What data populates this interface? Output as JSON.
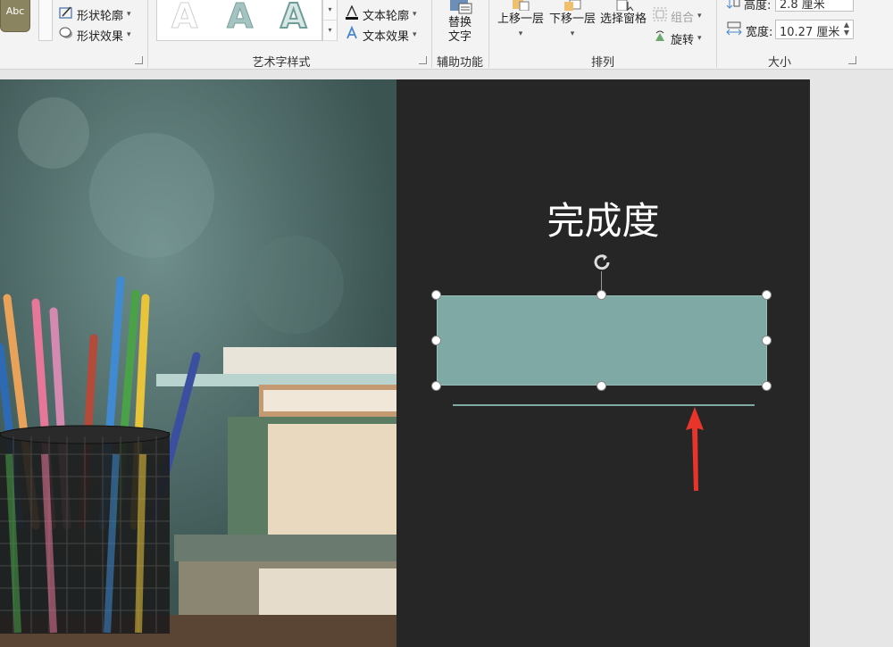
{
  "ribbon": {
    "abc_swatch": "Abc",
    "shape_outline": "形状轮廓",
    "shape_effects": "形状效果",
    "wordart_group_label": "艺术字样式",
    "text_outline": "文本轮廓",
    "text_effects": "文本效果",
    "wordart_sample": "A",
    "alt_text_line1": "替换",
    "alt_text_line2": "文字",
    "accessibility_label": "辅助功能",
    "bring_forward": "上移一层",
    "send_backward": "下移一层",
    "selection_pane": "选择窗格",
    "group": "组合",
    "rotate": "旋转",
    "arrange_label": "排列",
    "height_label": "高度:",
    "height_value": "2.8 厘米",
    "width_label": "宽度:",
    "width_value": "10.27 厘米",
    "size_label": "大小"
  },
  "slide": {
    "title": "完成度"
  },
  "colors": {
    "bar_fill": "#7ea9a5",
    "slide_dark": "#262626",
    "annotation_arrow": "#e8342a"
  }
}
